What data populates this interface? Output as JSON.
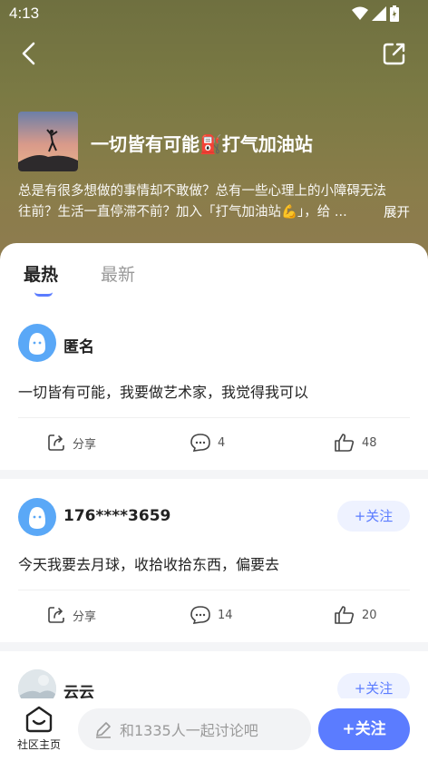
{
  "status_bar": {
    "time": "4:13"
  },
  "group": {
    "title": "一切皆有可能⛽打气加油站",
    "description_line1": "总是有很多想做的事情却不敢做？总有一些心理上的小障碍无法",
    "description_line2": "往前？生活一直停滞不前？加入「打气加油站💪」，给 ...",
    "expand_label": "展开"
  },
  "tabs": [
    {
      "label": "最热",
      "active": true
    },
    {
      "label": "最新",
      "active": false
    }
  ],
  "posts": [
    {
      "author": "匿名",
      "text": "一切皆有可能，我要做艺术家，我觉得我可以",
      "share_label": "分享",
      "comments": "4",
      "likes": "48",
      "show_follow": false
    },
    {
      "author": "176****3659",
      "text": "今天我要去月球，收拾收拾东西，偏要去",
      "share_label": "分享",
      "comments": "14",
      "likes": "20",
      "show_follow": true,
      "follow_label": "+关注"
    },
    {
      "author": "云云",
      "show_follow": true,
      "follow_label": "+关注"
    }
  ],
  "bottom_bar": {
    "home_label": "社区主页",
    "comment_placeholder": "和1335人一起讨论吧",
    "follow_label": "+关注"
  },
  "colors": {
    "accent": "#5b7cff",
    "avatar": "#5aa8f7"
  }
}
